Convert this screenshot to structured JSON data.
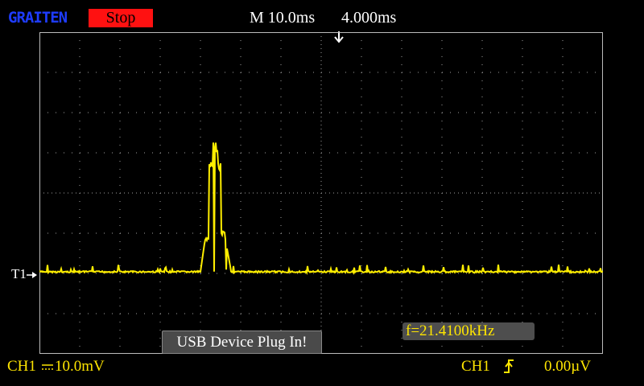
{
  "header": {
    "logo": "GRAITEN",
    "run_state": "Stop",
    "timebase": "M 10.0ms",
    "trigger_position": "4.000ms"
  },
  "channel_marker": "T1",
  "message": "USB Device Plug In!",
  "frequency": "f=21.4100kHz",
  "footer": {
    "channel": "CH1",
    "scale": "10.0mV",
    "trigger_source": "CH1",
    "trigger_level": "0.00µV"
  },
  "icons": {
    "coupling": "dc-coupling-icon",
    "edge": "rising-edge-icon",
    "trigger_marker": "down-arrow-icon",
    "channel_arrow": "right-arrow-icon"
  },
  "colors": {
    "trace": "#ffee00",
    "run_state_bg": "#ff1111",
    "logo": "#1e3cff",
    "grid": "#a0a0a0",
    "message_bg": "#4a4a4a"
  }
}
